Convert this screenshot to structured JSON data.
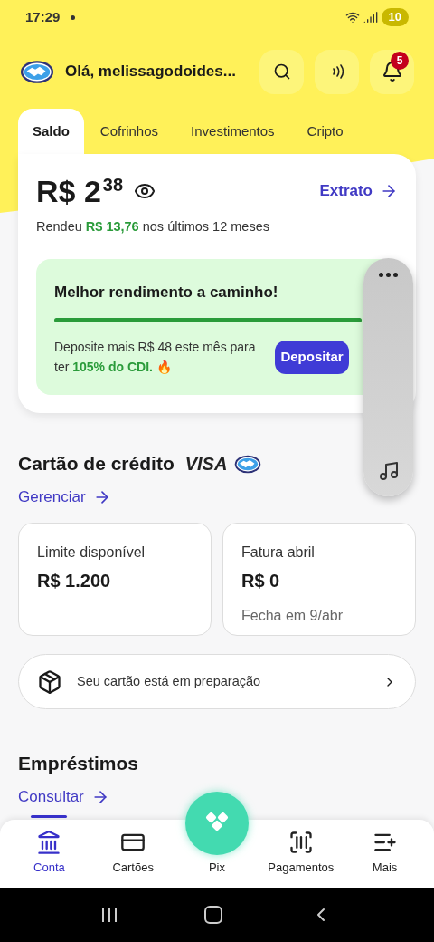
{
  "status_bar": {
    "time": "17:29",
    "battery": "10"
  },
  "header": {
    "greeting": "Olá, melissagodoides...",
    "notification_count": "5"
  },
  "tabs": [
    {
      "label": "Saldo",
      "selected": true
    },
    {
      "label": "Cofrinhos",
      "selected": false
    },
    {
      "label": "Investimentos",
      "selected": false
    },
    {
      "label": "Cripto",
      "selected": false
    }
  ],
  "balance": {
    "amount": "R$ 2",
    "cents": "38",
    "statement_link": "Extrato",
    "yield_prefix": "Rendeu",
    "yield_amount": "R$ 13,76",
    "yield_suffix": "nos últimos 12 meses"
  },
  "promo": {
    "title": "Melhor rendimento a caminho!",
    "level": 1,
    "text_prefix": "Deposite mais R$ 48 este mês para ter",
    "text_highlight": "105% do CDI.",
    "text_suffix": "🔥",
    "button": "Depositar"
  },
  "credit_card": {
    "title": "Cartão de crédito",
    "brand": "VISA",
    "link": "Gerenciar",
    "cards": [
      {
        "label": "Limite disponível",
        "value": "R$ 1.200"
      },
      {
        "label": "Fatura abril",
        "value": "R$ 0",
        "note": "Fecha em 9/abr"
      }
    ],
    "notice": "Seu cartão está em preparação"
  },
  "loans": {
    "title": "Empréstimos",
    "link": "Consultar"
  },
  "bottom_nav": [
    {
      "kind": "bank",
      "label": "Conta",
      "selected": true
    },
    {
      "kind": "card",
      "label": "Cartões",
      "selected": false
    },
    {
      "kind": "pix",
      "label": "Pix",
      "selected": false
    },
    {
      "kind": "barcode",
      "label": "Pagamentos",
      "selected": false
    },
    {
      "kind": "more",
      "label": "Mais",
      "selected": false
    }
  ]
}
